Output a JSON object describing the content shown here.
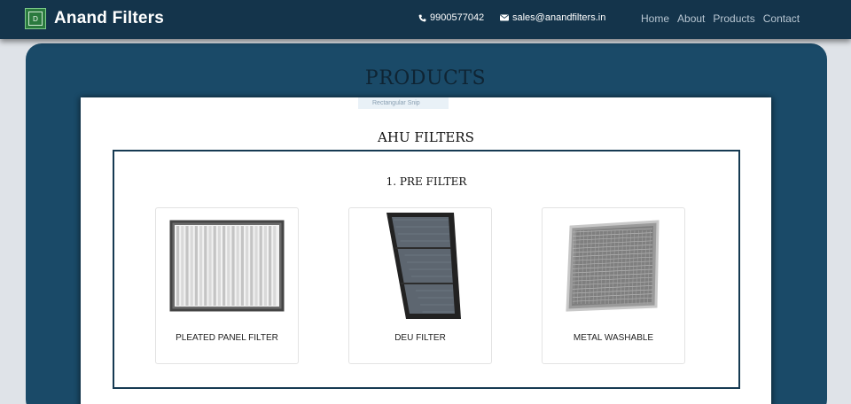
{
  "navbar": {
    "brand": "Anand Filters",
    "logo_letter": "D",
    "phone": "9900577042",
    "email": "sales@anandfilters.in",
    "links": [
      "Home",
      "About",
      "Products",
      "Contact"
    ]
  },
  "page": {
    "title": "PRODUCTS",
    "ghost_tooltip": "Rectangular Snip"
  },
  "section": {
    "title": "AHU FILTERS",
    "subsection_title": "1. PRE FILTER",
    "products": [
      {
        "name": "PLEATED PANEL FILTER"
      },
      {
        "name": "DEU FILTER"
      },
      {
        "name": "METAL WASHABLE"
      }
    ]
  },
  "colors": {
    "navbar": "#14344b",
    "panel": "#1a4a68",
    "page_bg": "#dfe3e8"
  }
}
